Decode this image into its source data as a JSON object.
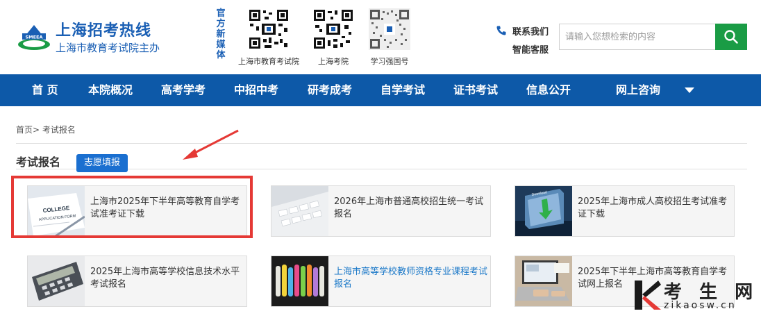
{
  "header": {
    "logo_title": "上海招考热线",
    "logo_subtitle": "上海市教育考试院主办",
    "logo_emblem_text": "SMEEA",
    "media_label": "官方新媒体",
    "qr_codes": [
      {
        "label": "上海市教育考试院"
      },
      {
        "label": "上海考院"
      },
      {
        "label": "学习强国号"
      }
    ],
    "contact_label": "联系我们",
    "service_label": "智能客服",
    "search_placeholder": "请输入您想检索的内容"
  },
  "nav": {
    "items": [
      "首 页",
      "本院概况",
      "高考学考",
      "中招中考",
      "研考成考",
      "自学考试",
      "证书考试",
      "信息公开",
      "网上咨询"
    ]
  },
  "breadcrumb": {
    "home": "首页",
    "separator": ">",
    "current": "考试报名"
  },
  "section": {
    "title": "考试报名",
    "tag_button": "志愿填报"
  },
  "cards": [
    {
      "text": "上海市2025年下半年高等教育自学考试准考证下载",
      "highlight": false
    },
    {
      "text": "2026年上海市普通高校招生统一考试报名",
      "highlight": false
    },
    {
      "text": "2025年上海市成人高校招生考试准考证下载",
      "highlight": false
    },
    {
      "text": "2025年上海市高等学校信息技术水平考试报名",
      "highlight": false
    },
    {
      "text": "上海市高等学校教师资格专业课程考试报名",
      "highlight": true
    },
    {
      "text": "2025年下半年上海市高等教育自学考试网上报名",
      "highlight": false
    }
  ],
  "thumb_texts": {
    "college": "COLLEGE",
    "application": "APPLICATION FORM",
    "download": "Download"
  },
  "watermark": {
    "brand": "考 生 网",
    "url": "zikaosw.cn"
  },
  "colors": {
    "nav_bg": "#0d59a8",
    "brand_blue": "#1a5fb4",
    "search_green": "#1a9c45",
    "tag_blue": "#1a6fd0",
    "highlight_red": "#e53935",
    "link_blue": "#1a78c8"
  }
}
